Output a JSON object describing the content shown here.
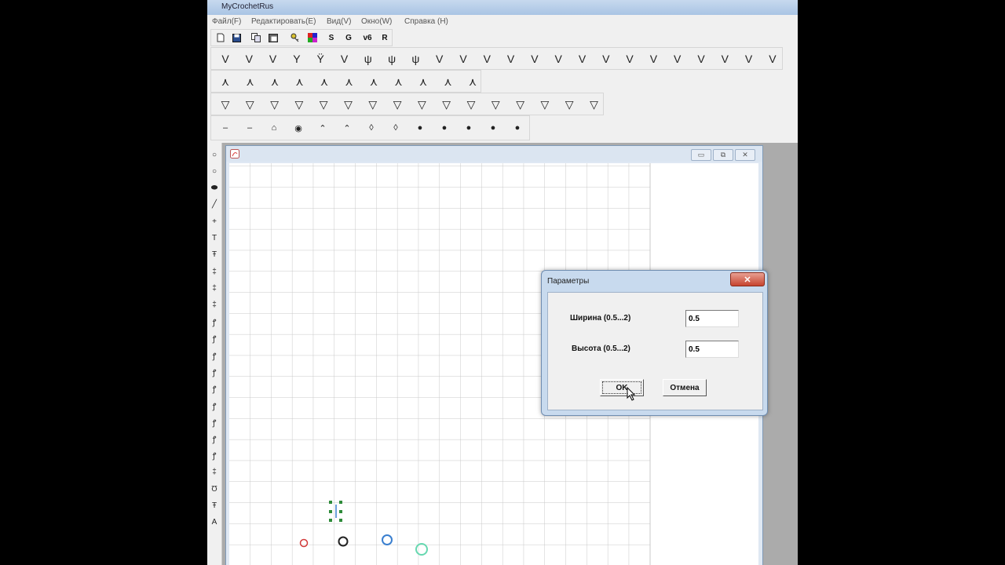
{
  "app": {
    "title": "MyCrochetRus"
  },
  "menu": [
    "Файл(F)",
    "Редактировать(E)",
    "Вид(V)",
    "Окно(W)",
    "Справка (H)"
  ],
  "toolbar_main": {
    "icons": [
      "new-file-icon",
      "save-icon",
      "copy-icon",
      "paste-icon",
      "key-icon",
      "palette-icon"
    ],
    "letters": [
      "S",
      "G",
      "v6",
      "R"
    ]
  },
  "stitch_rows": [
    [
      "V",
      "V",
      "V",
      "Y",
      "Ÿ",
      "V",
      "ψ",
      "ψ",
      "ψ",
      "V",
      "V",
      "V",
      "V",
      "V",
      "V",
      "V",
      "V",
      "V",
      "V",
      "V",
      "V",
      "V",
      "V",
      "V"
    ],
    [
      "⋏",
      "⋏",
      "⋏",
      "⋏",
      "⋏",
      "⋏",
      "⋏",
      "⋏",
      "⋏",
      "⋏",
      "⋏"
    ],
    [
      "▽",
      "▽",
      "▽",
      "▽",
      "▽",
      "▽",
      "▽",
      "▽",
      "▽",
      "▽",
      "▽",
      "▽",
      "▽",
      "▽",
      "▽",
      "▽"
    ],
    [
      "–",
      "–",
      "⌂",
      "◉",
      "⌃",
      "⌃",
      "◊",
      "◊",
      "●",
      "●",
      "●",
      "●",
      "●"
    ]
  ],
  "left_tools": [
    "○",
    "○",
    "⬬",
    "╱",
    "+",
    "T",
    "Ŧ",
    "‡",
    "‡",
    "‡",
    "ꝭ",
    "ꝭ",
    "ꝭ",
    "ꝭ",
    "ꝭ",
    "ꝭ",
    "ꝭ",
    "ꝭ",
    "ꝭ",
    "‡",
    "Ʊ",
    "Ŧ",
    "A"
  ],
  "doc_window": {
    "buttons": [
      "▭",
      "⧉",
      "✕"
    ]
  },
  "dialog": {
    "title": "Параметры",
    "close_label": "✕",
    "width_label": "Ширина (0.5...2)",
    "width_value": "0.5",
    "height_label": "Высота (0.5...2)",
    "height_value": "0.5",
    "ok_label": "OK",
    "cancel_label": "Отмена"
  },
  "colors": {
    "red": "#d23a3a",
    "black": "#222222",
    "blue": "#3a7fcf",
    "teal": "#66d8b0",
    "green": "#2e8b3a"
  }
}
